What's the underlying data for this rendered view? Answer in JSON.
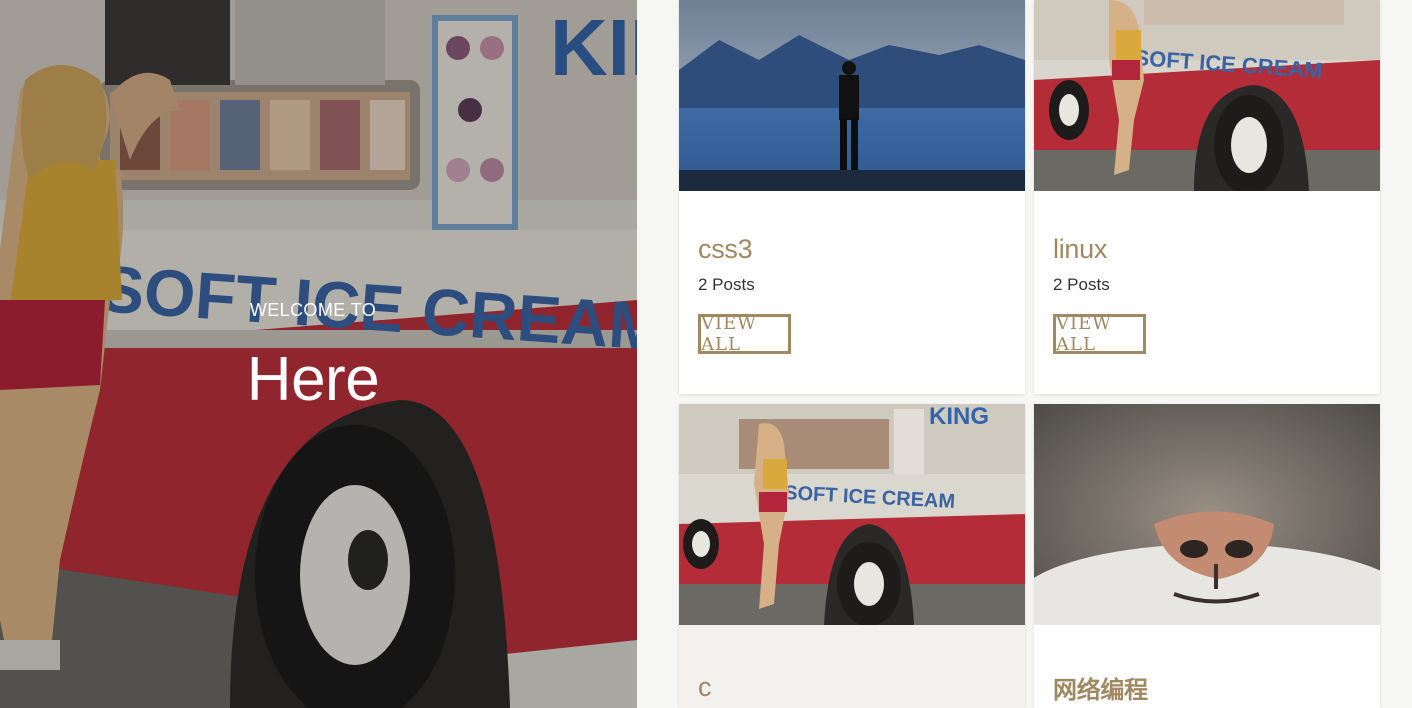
{
  "hero": {
    "kicker": "WELCOME TO",
    "title": "Here"
  },
  "categories": [
    {
      "name": "css3",
      "count": "2 Posts",
      "button": "VIEW ALL",
      "image": "lake-mountains-person-photo"
    },
    {
      "name": "linux",
      "count": "2 Posts",
      "button": "VIEW ALL",
      "image": "ice-cream-truck-photo"
    },
    {
      "name": "c",
      "image": "ice-cream-truck-photo"
    },
    {
      "name": "网络编程",
      "image": "cat-nose-closeup-photo"
    }
  ],
  "colors": {
    "accent": "#a08860",
    "page_bg": "#f6f6f4",
    "card_bg": "#ffffff"
  }
}
